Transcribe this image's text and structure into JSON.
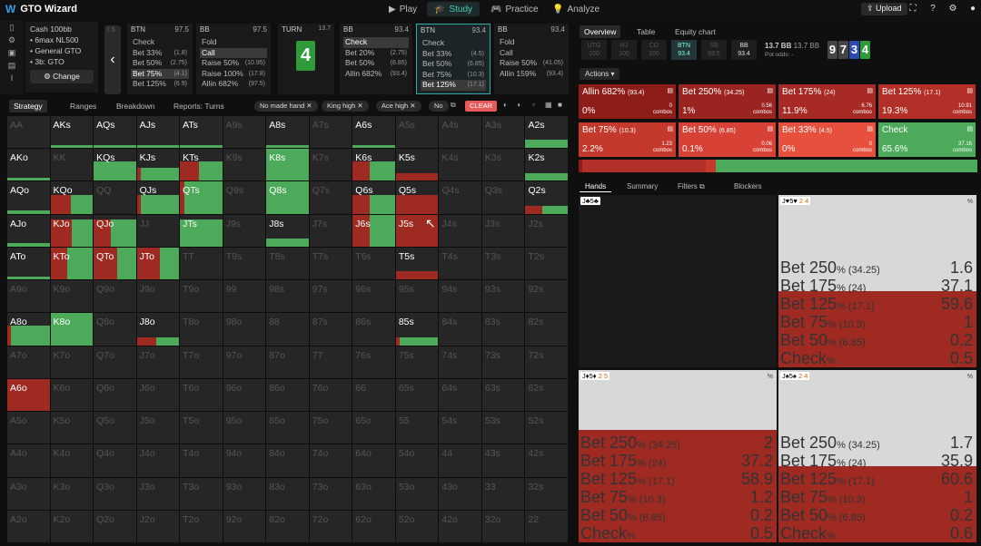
{
  "app": {
    "title": "GTO Wizard",
    "logo": "W"
  },
  "nav": [
    {
      "label": "Play",
      "icon": "play-icon"
    },
    {
      "label": "Study",
      "icon": "study-icon"
    },
    {
      "label": "Practice",
      "icon": "practice-icon"
    },
    {
      "label": "Analyze",
      "icon": "analyze-icon"
    }
  ],
  "topright": {
    "upload": "Upload"
  },
  "cash": {
    "title": "Cash",
    "stack": "100bb",
    "l1": "6max NL500",
    "l2": "General GTO",
    "l3": "3b: GTO",
    "change": "Change"
  },
  "back_label": "7.5",
  "columns": [
    {
      "pos": "BTN",
      "stack": "97.5",
      "items": [
        [
          "Check",
          ""
        ],
        [
          "Bet 33%",
          "(1.8)"
        ],
        [
          "Bet 50%",
          "(2.75)"
        ],
        [
          "Bet 75%",
          "(4.1)"
        ],
        [
          "Bet 125%",
          "(6.9)"
        ]
      ],
      "sel": 3
    },
    {
      "pos": "BB",
      "stack": "97.5",
      "items": [
        [
          "Fold",
          ""
        ],
        [
          "Call",
          ""
        ],
        [
          "Raise 50%",
          "(10.95)"
        ],
        [
          "Raise 100%",
          "(17.8)"
        ],
        [
          "Allin 682%",
          "(97.5)"
        ]
      ],
      "sel": 1
    },
    {
      "pos": "BB",
      "stack": "93.4",
      "items": [
        [
          "Check",
          ""
        ],
        [
          "Bet 20%",
          "(2.75)"
        ],
        [
          "Bet 50%",
          "(6.85)"
        ],
        [
          "Allin 682%",
          "(93.4)"
        ]
      ],
      "sel": 0
    },
    {
      "pos": "BTN",
      "stack": "93.4",
      "items": [
        [
          "Check",
          ""
        ],
        [
          "Bet 33%",
          "(4.5)"
        ],
        [
          "Bet 50%",
          "(6.85)"
        ],
        [
          "Bet 75%",
          "(10.3)"
        ],
        [
          "Bet 125%",
          "(17.1)"
        ]
      ],
      "sel": 4
    },
    {
      "pos": "BB",
      "stack": "93.4",
      "items": [
        [
          "Fold",
          ""
        ],
        [
          "Call",
          ""
        ],
        [
          "Raise 50%",
          "(41.05)"
        ],
        [
          "Allin 159%",
          "(93.4)"
        ]
      ],
      "sel": -1
    }
  ],
  "turn": {
    "label": "TURN",
    "pot": "13.7",
    "card": "4"
  },
  "strat_tabs": [
    "Strategy",
    "Ranges",
    "Breakdown",
    "Reports: Turns"
  ],
  "chips": [
    "No made hand",
    "King high",
    "Ace high",
    "No"
  ],
  "clear": "CLEAR",
  "grid": [
    [
      "AA",
      "AKs",
      "AQs",
      "AJs",
      "ATs",
      "A9s",
      "A8s",
      "A7s",
      "A6s",
      "A5s",
      "A4s",
      "A3s",
      "A2s"
    ],
    [
      "AKo",
      "KK",
      "KQs",
      "KJs",
      "KTs",
      "K9s",
      "K8s",
      "K7s",
      "K6s",
      "K5s",
      "K4s",
      "K3s",
      "K2s"
    ],
    [
      "AQo",
      "KQo",
      "QQ",
      "QJs",
      "QTs",
      "Q9s",
      "Q8s",
      "Q7s",
      "Q6s",
      "Q5s",
      "Q4s",
      "Q3s",
      "Q2s"
    ],
    [
      "AJo",
      "KJo",
      "QJo",
      "JJ",
      "JTs",
      "J9s",
      "J8s",
      "J7s",
      "J6s",
      "J5s",
      "J4s",
      "J3s",
      "J2s"
    ],
    [
      "ATo",
      "KTo",
      "QTo",
      "JTo",
      "TT",
      "T9s",
      "T8s",
      "T7s",
      "T6s",
      "T5s",
      "T4s",
      "T3s",
      "T2s"
    ],
    [
      "A9o",
      "K9o",
      "Q9o",
      "J9o",
      "T9o",
      "99",
      "98s",
      "97s",
      "96s",
      "95s",
      "94s",
      "93s",
      "92s"
    ],
    [
      "A8o",
      "K8o",
      "Q8o",
      "J8o",
      "T8o",
      "98o",
      "88",
      "87s",
      "86s",
      "85s",
      "84s",
      "83s",
      "82s"
    ],
    [
      "A7o",
      "K7o",
      "Q7o",
      "J7o",
      "T7o",
      "97o",
      "87o",
      "77",
      "76s",
      "75s",
      "74s",
      "73s",
      "72s"
    ],
    [
      "A6o",
      "K6o",
      "Q6o",
      "J6o",
      "T6o",
      "96o",
      "86o",
      "76o",
      "66",
      "65s",
      "64s",
      "63s",
      "62s"
    ],
    [
      "A5o",
      "K5o",
      "Q5o",
      "J5o",
      "T5o",
      "95o",
      "85o",
      "75o",
      "65o",
      "55",
      "54s",
      "53s",
      "52s"
    ],
    [
      "A4o",
      "K4o",
      "Q4o",
      "J4o",
      "T4o",
      "94o",
      "84o",
      "74o",
      "64o",
      "54o",
      "44",
      "43s",
      "42s"
    ],
    [
      "A3o",
      "K3o",
      "Q3o",
      "J3o",
      "T3o",
      "93o",
      "83o",
      "73o",
      "63o",
      "53o",
      "43o",
      "33",
      "32s"
    ],
    [
      "A2o",
      "K2o",
      "Q2o",
      "J2o",
      "T2o",
      "92o",
      "82o",
      "72o",
      "62o",
      "52o",
      "42o",
      "32o",
      "22"
    ]
  ],
  "right_tabs": [
    "Overview",
    "Table",
    "Equity chart"
  ],
  "positions": [
    {
      "n": "UTG",
      "v": "100"
    },
    {
      "n": "HJ",
      "v": "100"
    },
    {
      "n": "CO",
      "v": "100"
    },
    {
      "n": "BTN",
      "v": "93.4"
    },
    {
      "n": "SB",
      "v": "99.5"
    },
    {
      "n": "BB",
      "v": "93.4"
    }
  ],
  "pot": {
    "a": "13.7 BB",
    "b": "13.7 BB",
    "odds": "Pot odds:",
    "dash": "-"
  },
  "board": [
    {
      "r": "9",
      "c": "#444"
    },
    {
      "r": "7",
      "c": "#444"
    },
    {
      "r": "3",
      "c": "#2a4ab0"
    },
    {
      "r": "4",
      "c": "#2f9a3a"
    }
  ],
  "actions_label": "Actions",
  "actions": [
    {
      "name": "Allin 682%",
      "amt": "(93.4)",
      "pct": "0%",
      "combos": "0",
      "color": "#8e1d1a"
    },
    {
      "name": "Bet 250%",
      "amt": "(34.25)",
      "pct": "1%",
      "combos": "0.56",
      "color": "#9a2420"
    },
    {
      "name": "Bet 175%",
      "amt": "(24)",
      "pct": "11.9%",
      "combos": "6.76",
      "color": "#a82a24"
    },
    {
      "name": "Bet 125%",
      "amt": "(17.1)",
      "pct": "19.3%",
      "combos": "10.91",
      "color": "#b33028"
    },
    {
      "name": "Bet 75%",
      "amt": "(10.3)",
      "pct": "2.2%",
      "combos": "1.23",
      "color": "#c5382c"
    },
    {
      "name": "Bet 50%",
      "amt": "(6.85)",
      "pct": "0.1%",
      "combos": "0.06",
      "color": "#d84236"
    },
    {
      "name": "Bet 33%",
      "amt": "(4.5)",
      "pct": "0%",
      "combos": "0",
      "color": "#e8503e"
    },
    {
      "name": "Check",
      "amt": "",
      "pct": "65.6%",
      "combos": "37.16",
      "color": "#4caa5a"
    }
  ],
  "combos_word": "combos",
  "freq": [
    {
      "c": "#8e1d1a",
      "w": 1
    },
    {
      "c": "#b33028",
      "w": 31
    },
    {
      "c": "#c5382c",
      "w": 2.3
    },
    {
      "c": "#4caa5a",
      "w": 65.7
    }
  ],
  "hands_tabs": [
    "Hands",
    "Summary",
    "Filters",
    "Blockers"
  ],
  "hands": [
    {
      "tag": "J♣5♣",
      "tag2": "",
      "pct": "",
      "rows": [],
      "red": 0,
      "empty": true
    },
    {
      "tag": "J♥5♥",
      "tag2": "2  4",
      "pct": "%",
      "red": 84,
      "rows": [
        [
          "Bet 250",
          "(34.25)",
          "1.6"
        ],
        [
          "Bet 175",
          "(24)",
          "37.1"
        ],
        [
          "Bet 125",
          "(17.1)",
          "59.6"
        ],
        [
          "Bet 75",
          "(10.3)",
          "1"
        ],
        [
          "Bet 50",
          "(6.85)",
          "0.2"
        ],
        [
          "Check",
          "",
          "0.5"
        ]
      ]
    },
    {
      "tag": "J♦5♦",
      "tag2": "2  5",
      "pct": "%",
      "red": 124,
      "rows": [
        [
          "Bet 250",
          "(34.25)",
          "2"
        ],
        [
          "Bet 175",
          "(24)",
          "37.2"
        ],
        [
          "Bet 125",
          "(17.1)",
          "58.9"
        ],
        [
          "Bet 75",
          "(10.3)",
          "1.2"
        ],
        [
          "Bet 50",
          "(6.85)",
          "0.2"
        ],
        [
          "Check",
          "",
          "0.5"
        ]
      ]
    },
    {
      "tag": "J♠5♠",
      "tag2": "2  4",
      "pct": "%",
      "red": 84,
      "rows": [
        [
          "Bet 250",
          "(34.25)",
          "1.7"
        ],
        [
          "Bet 175",
          "(24)",
          "35.9"
        ],
        [
          "Bet 125",
          "(17.1)",
          "60.6"
        ],
        [
          "Bet 75",
          "(10.3)",
          "1"
        ],
        [
          "Bet 50",
          "(6.85)",
          "0.2"
        ],
        [
          "Check",
          "",
          "0.6"
        ]
      ]
    }
  ],
  "colors": {
    "green": "#4caa5a",
    "red": "#9e2a22",
    "darkred": "#7a1c18"
  }
}
